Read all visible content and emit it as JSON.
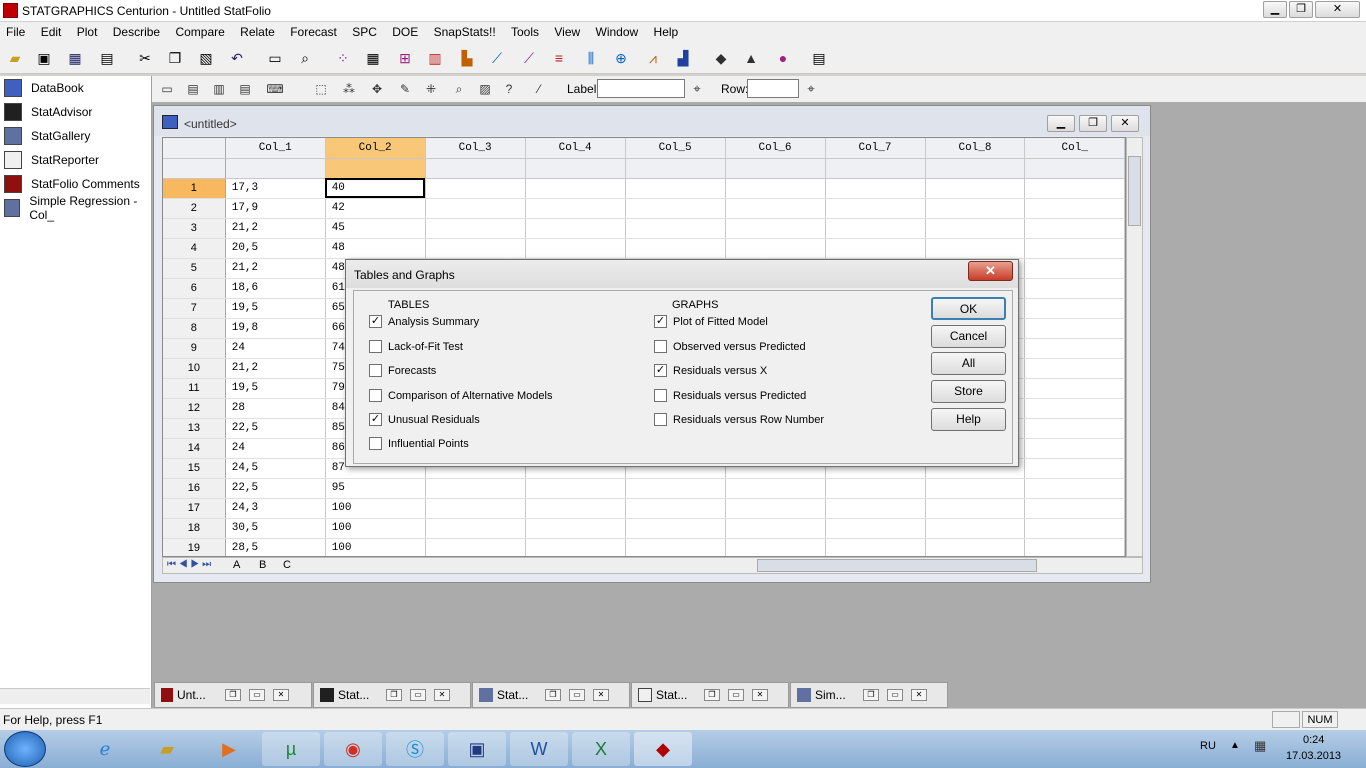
{
  "app": {
    "title": "STATGRAPHICS Centurion - Untitled StatFolio",
    "min": "▁",
    "max": "❐",
    "close": "✕"
  },
  "menu": [
    "File",
    "Edit",
    "Plot",
    "Describe",
    "Compare",
    "Relate",
    "Forecast",
    "SPC",
    "DOE",
    "SnapStats!!",
    "Tools",
    "View",
    "Window",
    "Help"
  ],
  "toolbar2": {
    "label_text": "Label:",
    "row_text": "Row:"
  },
  "leftpane": {
    "items": [
      "DataBook",
      "StatAdvisor",
      "StatGallery",
      "StatReporter",
      "StatFolio Comments",
      "Simple Regression - Col_"
    ]
  },
  "sheet": {
    "title": "<untitled>",
    "columns": [
      "Col_1",
      "Col_2",
      "Col_3",
      "Col_4",
      "Col_5",
      "Col_6",
      "Col_7",
      "Col_8",
      "Col_"
    ],
    "rows": [
      [
        "1",
        "17,3",
        "40"
      ],
      [
        "2",
        "17,9",
        "42"
      ],
      [
        "3",
        "21,2",
        "45"
      ],
      [
        "4",
        "20,5",
        "48"
      ],
      [
        "5",
        "21,2",
        "48"
      ],
      [
        "6",
        "18,6",
        "61"
      ],
      [
        "7",
        "19,5",
        "65"
      ],
      [
        "8",
        "19,8",
        "66"
      ],
      [
        "9",
        "24",
        "74"
      ],
      [
        "10",
        "21,2",
        "75"
      ],
      [
        "11",
        "19,5",
        "79"
      ],
      [
        "12",
        "28",
        "84"
      ],
      [
        "13",
        "22,5",
        "85"
      ],
      [
        "14",
        "24",
        "86"
      ],
      [
        "15",
        "24,5",
        "87"
      ],
      [
        "16",
        "22,5",
        "95"
      ],
      [
        "17",
        "24,3",
        "100"
      ],
      [
        "18",
        "30,5",
        "100"
      ],
      [
        "19",
        "28,5",
        "100"
      ]
    ],
    "sheet_tabs": [
      "A",
      "B",
      "C"
    ]
  },
  "dialog": {
    "title": "Tables and Graphs",
    "close": "✕",
    "tables_header": "TABLES",
    "graphs_header": "GRAPHS",
    "tables": [
      {
        "label": "Analysis Summary",
        "checked": "✓"
      },
      {
        "label": "Lack-of-Fit Test",
        "checked": ""
      },
      {
        "label": "Forecasts",
        "checked": ""
      },
      {
        "label": "Comparison of Alternative Models",
        "checked": ""
      },
      {
        "label": "Unusual Residuals",
        "checked": "✓"
      },
      {
        "label": "Influential Points",
        "checked": ""
      }
    ],
    "graphs": [
      {
        "label": "Plot of Fitted Model",
        "checked": "✓"
      },
      {
        "label": "Observed versus Predicted",
        "checked": ""
      },
      {
        "label": "Residuals versus X",
        "checked": "✓"
      },
      {
        "label": "Residuals versus Predicted",
        "checked": ""
      },
      {
        "label": "Residuals versus Row Number",
        "checked": ""
      }
    ],
    "buttons": [
      "OK",
      "Cancel",
      "All",
      "Store",
      "Help"
    ]
  },
  "taskbuttons": [
    "Unt...",
    "Stat...",
    "Stat...",
    "Stat...",
    "Sim..."
  ],
  "status": {
    "help": "For Help, press F1",
    "num": "NUM"
  },
  "tray": {
    "lang": "RU",
    "time": "0:24",
    "date": "17.03.2013"
  }
}
